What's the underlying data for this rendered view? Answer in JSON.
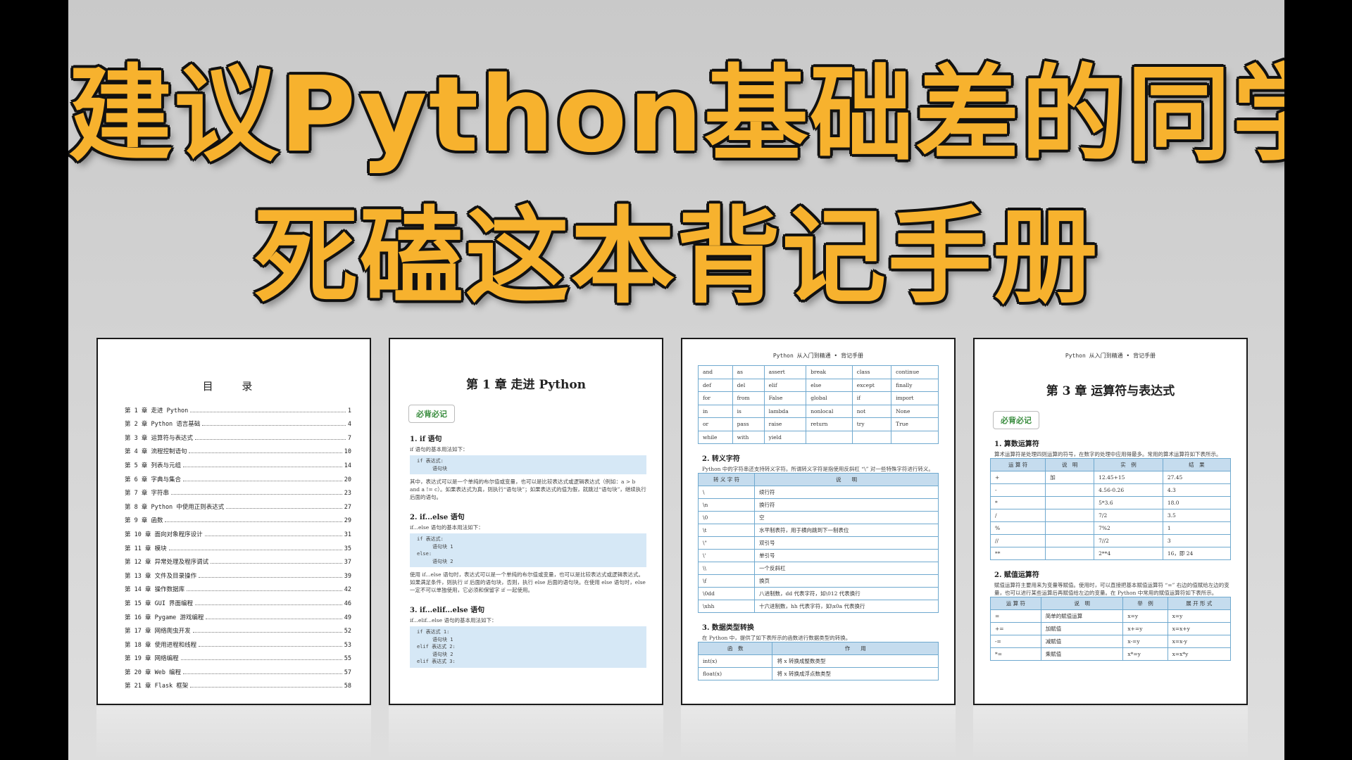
{
  "headline": {
    "line1": "建议Python基础差的同学",
    "line2": "死磕这本背记手册"
  },
  "toc": {
    "title": "目 录",
    "items": [
      {
        "t": "第 1 章 走进 Python",
        "n": "1"
      },
      {
        "t": "第 2 章 Python 语言基础",
        "n": "4"
      },
      {
        "t": "第 3 章 运算符与表达式",
        "n": "7"
      },
      {
        "t": "第 4 章 流程控制语句",
        "n": "10"
      },
      {
        "t": "第 5 章 列表与元组",
        "n": "14"
      },
      {
        "t": "第 6 章 字典与集合",
        "n": "20"
      },
      {
        "t": "第 7 章 字符串",
        "n": "23"
      },
      {
        "t": "第 8 章 Python 中使用正则表达式",
        "n": "27"
      },
      {
        "t": "第 9 章 函数",
        "n": "29"
      },
      {
        "t": "第 10 章 面向对象程序设计",
        "n": "31"
      },
      {
        "t": "第 11 章 模块",
        "n": "35"
      },
      {
        "t": "第 12 章 异常处理及程序调试",
        "n": "37"
      },
      {
        "t": "第 13 章 文件及目录操作",
        "n": "39"
      },
      {
        "t": "第 14 章 操作数据库",
        "n": "42"
      },
      {
        "t": "第 15 章 GUI 界面编程",
        "n": "46"
      },
      {
        "t": "第 16 章 Pygame 游戏编程",
        "n": "49"
      },
      {
        "t": "第 17 章 网络爬虫开发",
        "n": "52"
      },
      {
        "t": "第 18 章 使用进程和线程",
        "n": "53"
      },
      {
        "t": "第 19 章 网络编程",
        "n": "55"
      },
      {
        "t": "第 20 章 Web 编程",
        "n": "57"
      },
      {
        "t": "第 21 章 Flask 框架",
        "n": "58"
      }
    ]
  },
  "ch1": {
    "title": "第 1 章  走进 Python",
    "badge": "必背必记",
    "s1": "1. if 语句",
    "s1_intro": "if 语句的基本用法如下：",
    "s1_code": [
      "if 表达式:",
      "语句块"
    ],
    "s1_desc": "其中，表达式可以是一个单纯的布尔值或变量，也可以是比较表达式或逻辑表达式（例如：a > b and a != c）。如果表达式为真，则执行“语句块”；如果表达式的值为假，就跳过“语句块”，继续执行后面的语句。",
    "s2": "2. if...else 语句",
    "s2_intro": "if...else 语句的基本用法如下：",
    "s2_code": [
      "if 表达式:",
      "语句块 1",
      "else:",
      "语句块 2"
    ],
    "s2_desc": "使用 if...else 语句时，表达式可以是一个单纯的布尔值或变量，也可以是比较表达式或逻辑表达式。如果满足条件，则执行 if 后面的语句块，否则，执行 else 后面的语句块。在使用 else 语句时，else 一定不可以单独使用，它必须和保留字 if 一起使用。",
    "s3": "3. if...elif...else 语句",
    "s3_intro": "if...elif...else 语句的基本用法如下：",
    "s3_code": [
      "if 表达式 1:",
      "语句块 1",
      "elif 表达式 2:",
      "语句块 2",
      "elif 表达式 3:"
    ]
  },
  "p3": {
    "runhead": "Python 从入门到精通 • 背记手册",
    "keywords": [
      [
        "and",
        "as",
        "assert",
        "break",
        "class",
        "continue"
      ],
      [
        "def",
        "del",
        "elif",
        "else",
        "except",
        "finally"
      ],
      [
        "for",
        "from",
        "False",
        "global",
        "if",
        "import"
      ],
      [
        "in",
        "is",
        "lambda",
        "nonlocal",
        "not",
        "None"
      ],
      [
        "or",
        "pass",
        "raise",
        "return",
        "try",
        "True"
      ],
      [
        "while",
        "with",
        "yield",
        "",
        "",
        ""
      ]
    ],
    "s2": "2. 转义字符",
    "s2_desc": "Python 中的字符串还支持转义字符。所谓转义字符是指使用反斜杠 “\\” 对一些特殊字符进行转义。",
    "esc_header": [
      "转 义 字 符",
      "说　　明"
    ],
    "esc_rows": [
      [
        "\\",
        "续行符"
      ],
      [
        "\\n",
        "换行符"
      ],
      [
        "\\0",
        "空"
      ],
      [
        "\\t",
        "水平制表符，用于横向跳到下一制表位"
      ],
      [
        "\\\"",
        "双引号"
      ],
      [
        "\\'",
        "单引号"
      ],
      [
        "\\\\",
        "一个反斜杠"
      ],
      [
        "\\f",
        "换页"
      ],
      [
        "\\0dd",
        "八进制数，dd 代表字符，如\\012 代表换行"
      ],
      [
        "\\xhh",
        "十六进制数，hh 代表字符，如\\x0a 代表换行"
      ]
    ],
    "s3": "3. 数据类型转换",
    "s3_desc": "在 Python 中，提供了如下表所示的函数进行数据类型的转换。",
    "conv_header": [
      "函　数",
      "作　　用"
    ],
    "conv_rows": [
      [
        "int(x)",
        "将 x 转换成整数类型"
      ],
      [
        "float(x)",
        "将 x 转换成浮点数类型"
      ]
    ]
  },
  "ch3": {
    "runhead": "Python 从入门到精通 • 背记手册",
    "title": "第 3 章  运算符与表达式",
    "badge": "必背必记",
    "s1": "1. 算数运算符",
    "s1_desc": "算术运算符是处理四则运算的符号，在数字的处理中应用得最多。常用的算术运算符如下表所示。",
    "arith_header": [
      "运 算 符",
      "说　明",
      "实　例",
      "结　果"
    ],
    "arith_rows": [
      [
        "+",
        "加",
        "12.45+15",
        "27.45"
      ],
      [
        "-",
        "",
        "4.56-0.26",
        "4.3"
      ],
      [
        "*",
        "",
        "5*3.6",
        "18.0"
      ],
      [
        "/",
        "",
        "7/2",
        "3.5"
      ],
      [
        "%",
        "",
        "7%2",
        "1"
      ],
      [
        "//",
        "",
        "7//2",
        "3"
      ],
      [
        "**",
        "",
        "2**4",
        "16，即 24"
      ]
    ],
    "s2": "2. 赋值运算符",
    "s2_desc": "赋值运算符主要用来为变量等赋值。使用时，可以直接把基本赋值运算符 “=” 右边的值赋给左边的变量，也可以进行某些运算后再赋值给左边的变量。在 Python 中常用的赋值运算符如下表所示。",
    "assign_header": [
      "运 算 符",
      "说　明",
      "举　例",
      "展 开 形 式"
    ],
    "assign_rows": [
      [
        "=",
        "简单的赋值运算",
        "x=y",
        "x=y"
      ],
      [
        "+=",
        "加赋值",
        "x+=y",
        "x=x+y"
      ],
      [
        "-=",
        "减赋值",
        "x-=y",
        "x=x-y"
      ],
      [
        "*=",
        "乘赋值",
        "x*=y",
        "x=x*y"
      ]
    ]
  }
}
